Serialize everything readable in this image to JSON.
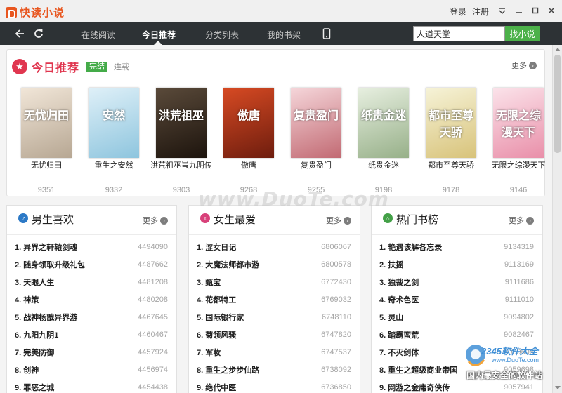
{
  "app": {
    "name": "快读小说"
  },
  "titlebar": {
    "login": "登录",
    "register": "注册"
  },
  "nav": {
    "items": [
      {
        "label": "在线阅读"
      },
      {
        "label": "今日推荐"
      },
      {
        "label": "分类列表"
      },
      {
        "label": "我的书架"
      }
    ],
    "active": "今日推荐"
  },
  "search": {
    "value": "人道天堂",
    "button": "找小说"
  },
  "recommend": {
    "title": "今日推荐",
    "tag_done": "完结",
    "tag_serial": "连载",
    "more": "更多",
    "books": [
      {
        "name": "无忧归田",
        "count": "9351",
        "cover_text": "无忧归田",
        "c1": "#f1e6d8",
        "c2": "#b7a793"
      },
      {
        "name": "重生之安然",
        "count": "9332",
        "cover_text": "安然",
        "c1": "#dff0f8",
        "c2": "#8ec5de"
      },
      {
        "name": "洪荒祖巫蚩九阴传",
        "count": "9303",
        "cover_text": "洪荒祖巫",
        "c1": "#5a4a3a",
        "c2": "#1d140d"
      },
      {
        "name": "傲唐",
        "count": "9268",
        "cover_text": "傲唐",
        "c1": "#d74a23",
        "c2": "#6e1d0e"
      },
      {
        "name": "复贵盈门",
        "count": "9255",
        "cover_text": "复贵盈门",
        "c1": "#f5d6da",
        "c2": "#c26a73"
      },
      {
        "name": "纸贵金迷",
        "count": "9198",
        "cover_text": "纸贵金迷",
        "c1": "#e7efe0",
        "c2": "#97b089"
      },
      {
        "name": "都市至尊天骄",
        "count": "9178",
        "cover_text": "都市至尊天骄",
        "c1": "#f6f3d8",
        "c2": "#d8c37a"
      },
      {
        "name": "无限之综漫天下",
        "count": "9146",
        "cover_text": "无限之综漫天下",
        "c1": "#fbe3ea",
        "c2": "#e98fa9"
      }
    ]
  },
  "rank_male": {
    "title": "男生喜欢",
    "more": "更多",
    "color": "#2c79c6",
    "items": [
      {
        "name": "1. 异界之轩辕剑魂",
        "value": "4494090"
      },
      {
        "name": "2. 随身领取升级礼包",
        "value": "4487662"
      },
      {
        "name": "3. 天眼人生",
        "value": "4481208"
      },
      {
        "name": "4. 神策",
        "value": "4480208"
      },
      {
        "name": "5. 战神杨戬异界游",
        "value": "4467645"
      },
      {
        "name": "6. 九阳九阴1",
        "value": "4460467"
      },
      {
        "name": "7. 完美防御",
        "value": "4457924"
      },
      {
        "name": "8. 创神",
        "value": "4456974"
      },
      {
        "name": "9. 罪恶之城",
        "value": "4454438"
      }
    ]
  },
  "rank_female": {
    "title": "女生最爱",
    "more": "更多",
    "color": "#d8417a",
    "items": [
      {
        "name": "1. 涩女日记",
        "value": "6806067"
      },
      {
        "name": "2. 大魔法师都市游",
        "value": "6800578"
      },
      {
        "name": "3. 甄宝",
        "value": "6772430"
      },
      {
        "name": "4. 花都特工",
        "value": "6769032"
      },
      {
        "name": "5. 国际银行家",
        "value": "6748110"
      },
      {
        "name": "6. 菊领风骚",
        "value": "6747820"
      },
      {
        "name": "7. 军妆",
        "value": "6747537"
      },
      {
        "name": "8. 重生之步步仙路",
        "value": "6738092"
      },
      {
        "name": "9. 绝代中医",
        "value": "6736850"
      }
    ]
  },
  "rank_hot": {
    "title": "热门书榜",
    "more": "更多",
    "color": "#43a047",
    "items": [
      {
        "name": "1. 艳遇该解各忘录",
        "value": "9134319"
      },
      {
        "name": "2. 扶摇",
        "value": "9113169"
      },
      {
        "name": "3. 独裁之剑",
        "value": "9111686"
      },
      {
        "name": "4. 奇术色医",
        "value": "9111010"
      },
      {
        "name": "5. 灵山",
        "value": "9094802"
      },
      {
        "name": "6. 踏霸蛮荒",
        "value": "9082467"
      },
      {
        "name": "7. 不灭剑体",
        "value": "9059698"
      },
      {
        "name": "8. 重生之超级商业帝国",
        "value": "9059698"
      },
      {
        "name": "9. 网游之金庸奇侠传",
        "value": "9057941"
      }
    ]
  },
  "watermark": {
    "site": "www.DuoTe.com",
    "brand": "2345软件大全",
    "url": "www.DuoTe.com",
    "slogan": "国内最安全的软件站"
  }
}
